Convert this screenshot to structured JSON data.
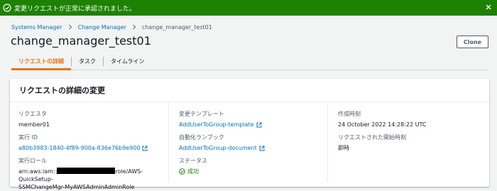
{
  "flash": {
    "message": "変更リクエストが正常に承認されました。",
    "icon": "check-circle-icon",
    "close_icon": "close-icon",
    "color": "#1d8102"
  },
  "breadcrumb": {
    "items": [
      "Systems Manager",
      "Change Manager"
    ],
    "current": "change_manager_test01"
  },
  "page": {
    "title": "change_manager_test01",
    "clone_label": "Clone"
  },
  "tabs": [
    {
      "label": "リクエストの詳細",
      "active": true
    },
    {
      "label": "タスク",
      "active": false
    },
    {
      "label": "タイムライン",
      "active": false
    }
  ],
  "card": {
    "title": "リクエストの詳細の変更",
    "requester_label": "リクエスタ",
    "requester": "member01",
    "execution_id_label": "実行 ID",
    "execution_id": "a80b3983-1840-4f89-900a-836e76b9e900",
    "execution_role_label": "実行ロール",
    "execution_role_prefix": "arn:aws:iam::",
    "execution_role_suffix": "role/AWS-QuickSetup-",
    "execution_role_line2": "SSMChangeMgr-MyAWSAdminAdminRole",
    "template_label": "変更テンプレート",
    "template": "AddUserToGroup-template",
    "runbook_label": "自動化ランブック",
    "runbook": "AddUserToGroup-document",
    "status_label": "ステータス",
    "status": "成功",
    "created_label": "作成時刻",
    "created": "24 October 2022 14:28:22 UTC",
    "requested_start_label": "リクエストされた開始時刻",
    "requested_start": "即時"
  },
  "colors": {
    "link": "#0073bb",
    "accent": "#ec7211",
    "success": "#1d8102"
  }
}
